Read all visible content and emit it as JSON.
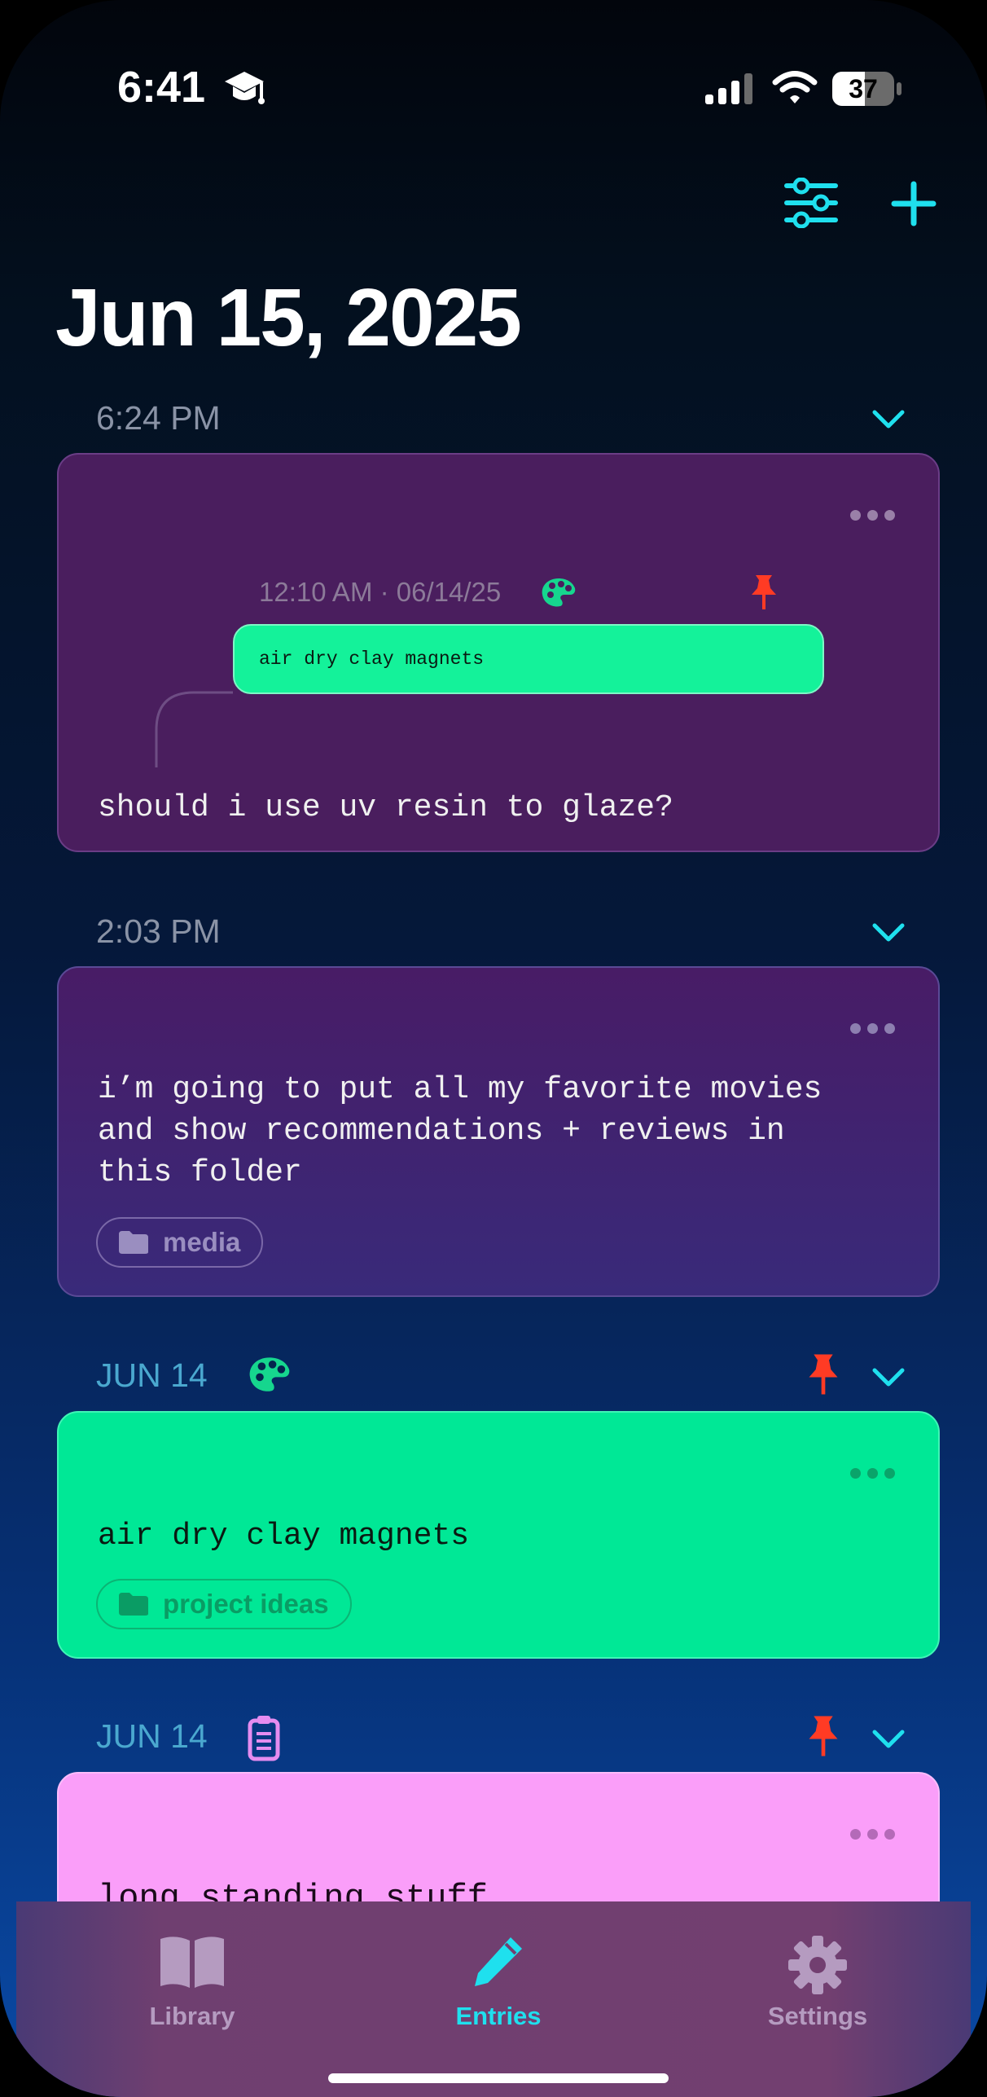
{
  "status_bar": {
    "time": "6:41",
    "battery": "37"
  },
  "header": {
    "date_title": "Jun 15, 2025"
  },
  "entries": [
    {
      "section_label": "6:24 PM",
      "quote": {
        "meta": "12:10 AM · 06/14/25",
        "bubble_text": "air dry clay magnets"
      },
      "text": "should i use uv resin to glaze?"
    },
    {
      "section_label": "2:03 PM",
      "text": "i’m going to put all my favorite movies\nand show recommendations + reviews in\nthis folder",
      "folder": "media"
    },
    {
      "section_label": "JUN 14",
      "text": "air dry clay magnets",
      "folder": "project ideas"
    },
    {
      "section_label": "JUN 14",
      "text": "long standing stuff"
    }
  ],
  "tab_bar": {
    "items": [
      {
        "label": "Library"
      },
      {
        "label": "Entries"
      },
      {
        "label": "Settings"
      }
    ]
  },
  "colors": {
    "accent": "#1fe0ee",
    "card_purple": "#4a1e5e",
    "card_green": "#00e896",
    "card_pink": "#fa9ef9",
    "pin_red": "#ff3b24"
  },
  "icons": [
    "graduation-cap-icon",
    "signal-icon",
    "wifi-icon",
    "battery-icon",
    "filter-sliders-icon",
    "plus-icon",
    "chevron-down-icon",
    "more-dots-icon",
    "palette-icon",
    "pin-icon",
    "clipboard-icon",
    "folder-icon",
    "book-icon",
    "pencil-icon",
    "gear-icon"
  ]
}
